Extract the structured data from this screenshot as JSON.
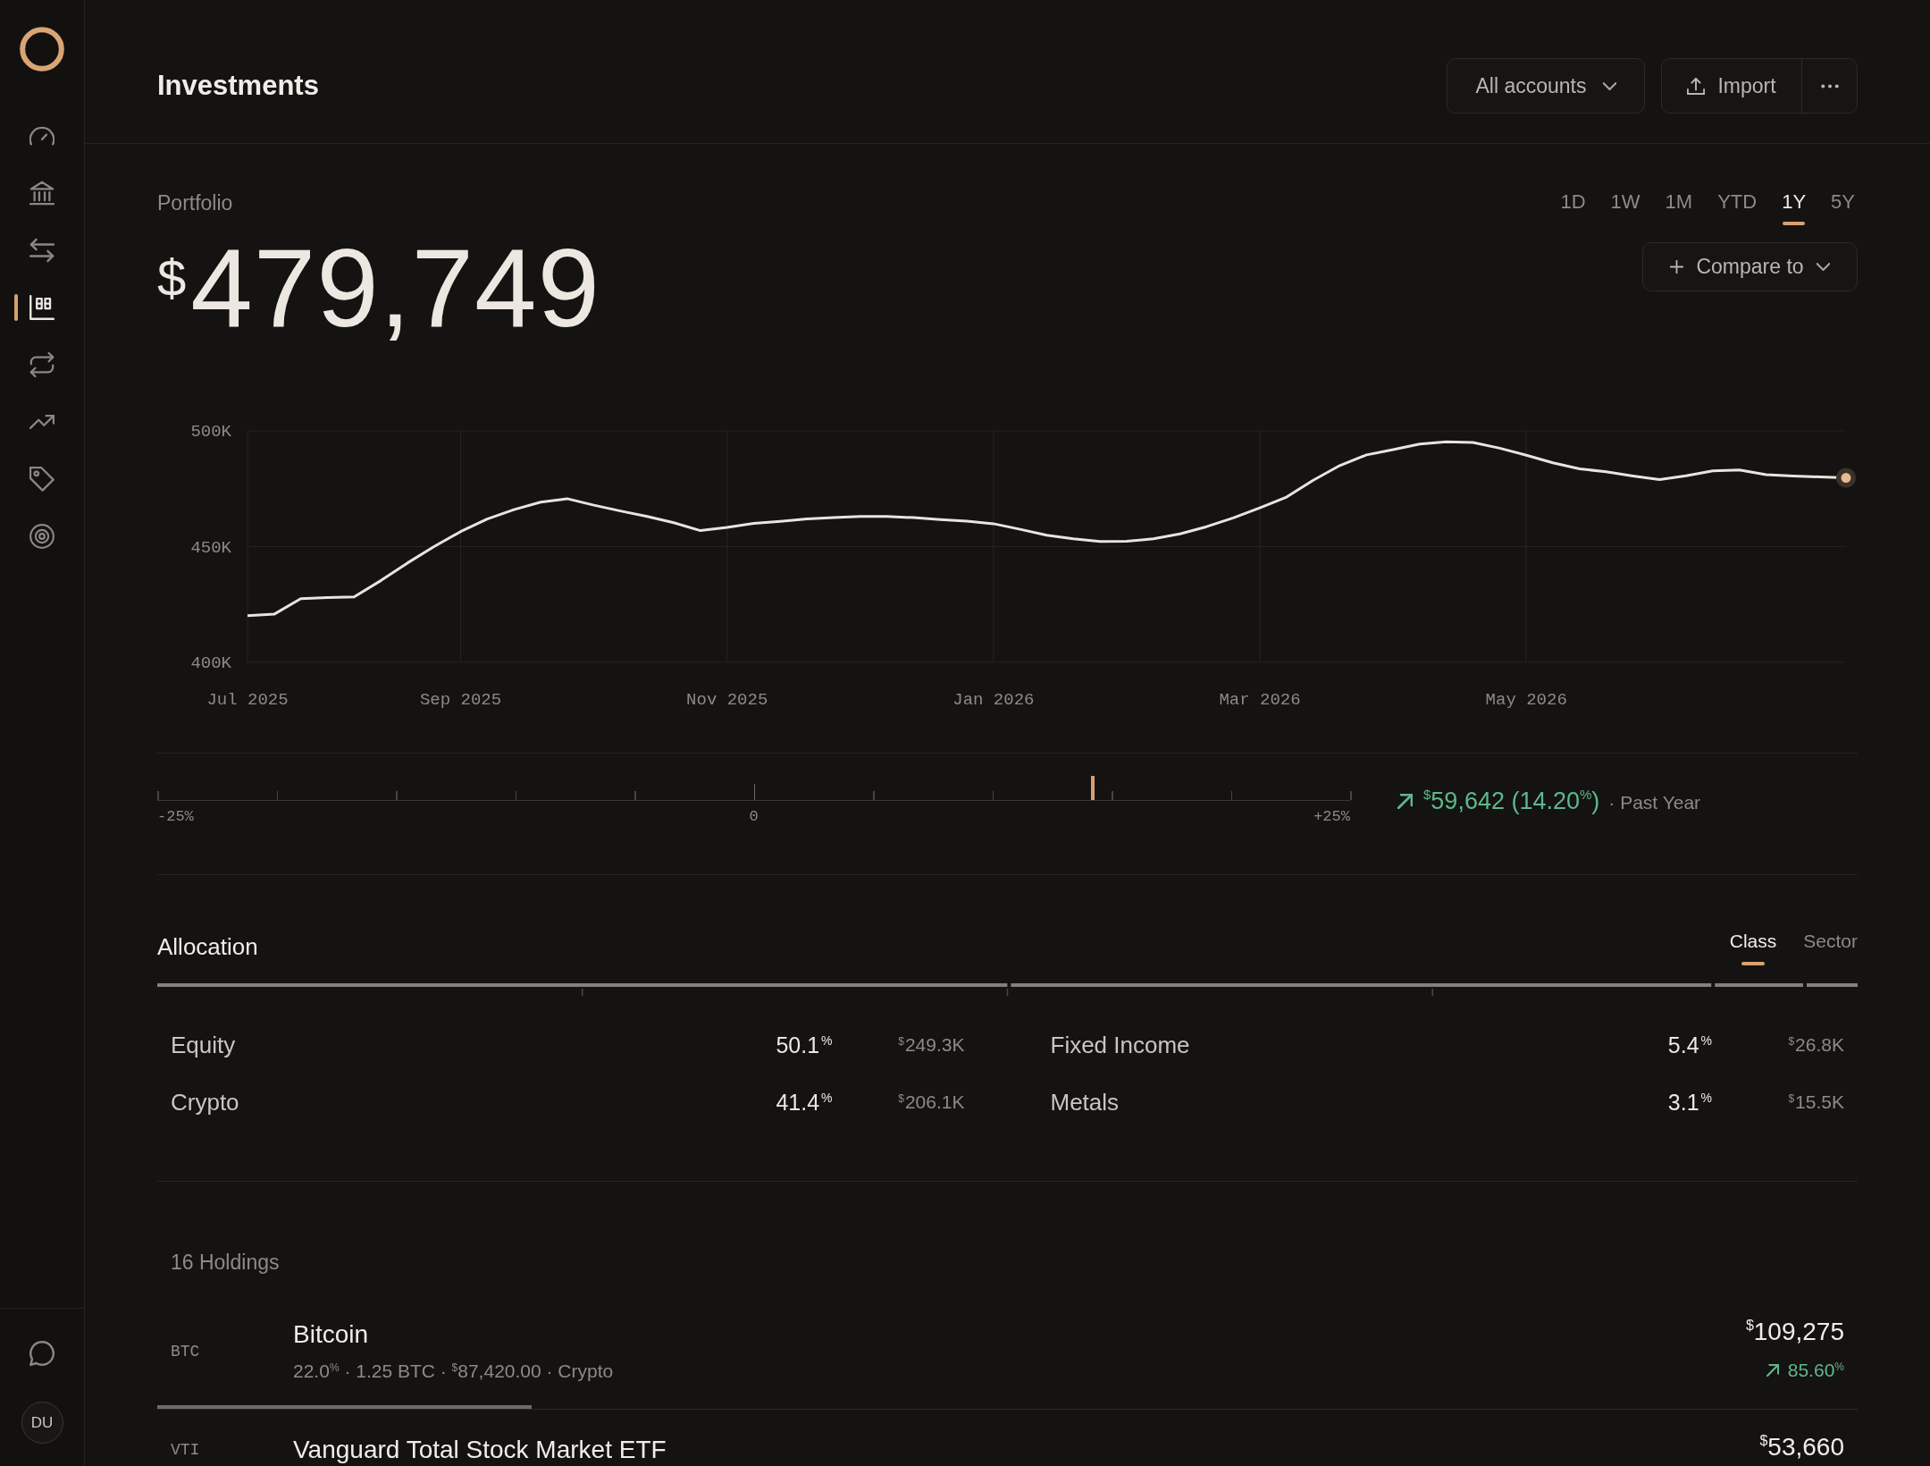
{
  "sidebar": {
    "items": [
      {
        "selected": false
      },
      {
        "selected": false
      },
      {
        "selected": false
      },
      {
        "selected": true
      },
      {
        "selected": false
      },
      {
        "selected": false
      },
      {
        "selected": false
      },
      {
        "selected": false
      }
    ],
    "user_initials": "DU"
  },
  "header": {
    "title": "Investments",
    "account_filter": "All accounts",
    "import_label": "Import"
  },
  "portfolio": {
    "label": "Portfolio",
    "value": "$^{$}$479,749",
    "ranges": [
      {
        "label": "1D",
        "selected": false
      },
      {
        "label": "1W",
        "selected": false
      },
      {
        "label": "1M",
        "selected": false
      },
      {
        "label": "YTD",
        "selected": false
      },
      {
        "label": "1Y",
        "selected": true
      },
      {
        "label": "5Y",
        "selected": false
      }
    ],
    "compare_label": "Compare to",
    "chart_data": {
      "type": "line",
      "grid": true,
      "categories": [
        "Jul 2025",
        null,
        null,
        null,
        null,
        null,
        null,
        null,
        "Sep 2025",
        null,
        null,
        null,
        null,
        null,
        null,
        null,
        null,
        null,
        "Nov 2025",
        null,
        null,
        null,
        null,
        null,
        null,
        null,
        null,
        null,
        "Jan 2026",
        null,
        null,
        null,
        null,
        null,
        null,
        null,
        null,
        null,
        "Mar 2026",
        null,
        null,
        null,
        null,
        null,
        null,
        null,
        null,
        null,
        "May 2026",
        null,
        null,
        null,
        null,
        null,
        null,
        null,
        null,
        null,
        null,
        null,
        null
      ],
      "series": [
        {
          "color": "#e8e4de",
          "values": [
            420200,
            420800,
            427500,
            428000,
            428300,
            435300,
            442900,
            450000,
            456500,
            461900,
            466000,
            469200,
            470700,
            467900,
            465400,
            463000,
            460300,
            456900,
            458300,
            460000,
            460900,
            462000,
            462500,
            463000,
            463000,
            462500,
            461700,
            461000,
            459900,
            457500,
            454900,
            453400,
            452200,
            452300,
            453400,
            455500,
            458600,
            462400,
            466700,
            471400,
            478700,
            485000,
            489600,
            491900,
            494300,
            495300,
            495000,
            492500,
            489500,
            486200,
            483600,
            482300,
            480500,
            478900,
            480600,
            482700,
            483100,
            481100,
            480500,
            480100,
            479700
          ]
        }
      ],
      "ylim": [
        400000,
        500000
      ],
      "yticks": [
        {
          "value": 400000,
          "label": "400K"
        },
        {
          "value": 450000,
          "label": "450K"
        },
        {
          "value": 500000,
          "label": "500K"
        }
      ]
    }
  },
  "performance": {
    "level": 0.784,
    "scale_labels": [
      "-25%",
      "0",
      "+25%"
    ],
    "change": {
      "positive": true,
      "amount": "$^{$}$59,642 (14.20$^{%}$)",
      "period": "· Past Year"
    }
  },
  "allocation": {
    "title": "Allocation",
    "tabs": [
      {
        "label": "Class",
        "selected": true
      },
      {
        "label": "Sector",
        "selected": false
      }
    ],
    "items": [
      {
        "name": "Equity",
        "percent": "50.1$^{%}$",
        "value": "$^{$}$249.3K"
      },
      {
        "name": "Crypto",
        "percent": "41.4$^{%}$",
        "value": "$^{$}$206.1K"
      },
      {
        "name": "Fixed Income",
        "percent": "5.4$^{%}$",
        "value": "$^{$}$26.8K"
      },
      {
        "name": "Metals",
        "percent": "3.1$^{%}$",
        "value": "$^{$}$15.5K"
      }
    ]
  },
  "holdings": {
    "count_label": "16 Holdings",
    "rows": [
      {
        "ticker": "BTC",
        "name": "Bitcoin",
        "details": "22.0$^{%}$ · 1.25 BTC · $^{$}$87,420.00 · Crypto",
        "value": "$^{$}$109,275",
        "change": "85.60$^{%}$",
        "positive": true,
        "level": 0.22
      },
      {
        "ticker": "VTI",
        "name": "Vanguard Total Stock Market ETF",
        "value": "$^{$}$53,660"
      }
    ]
  }
}
